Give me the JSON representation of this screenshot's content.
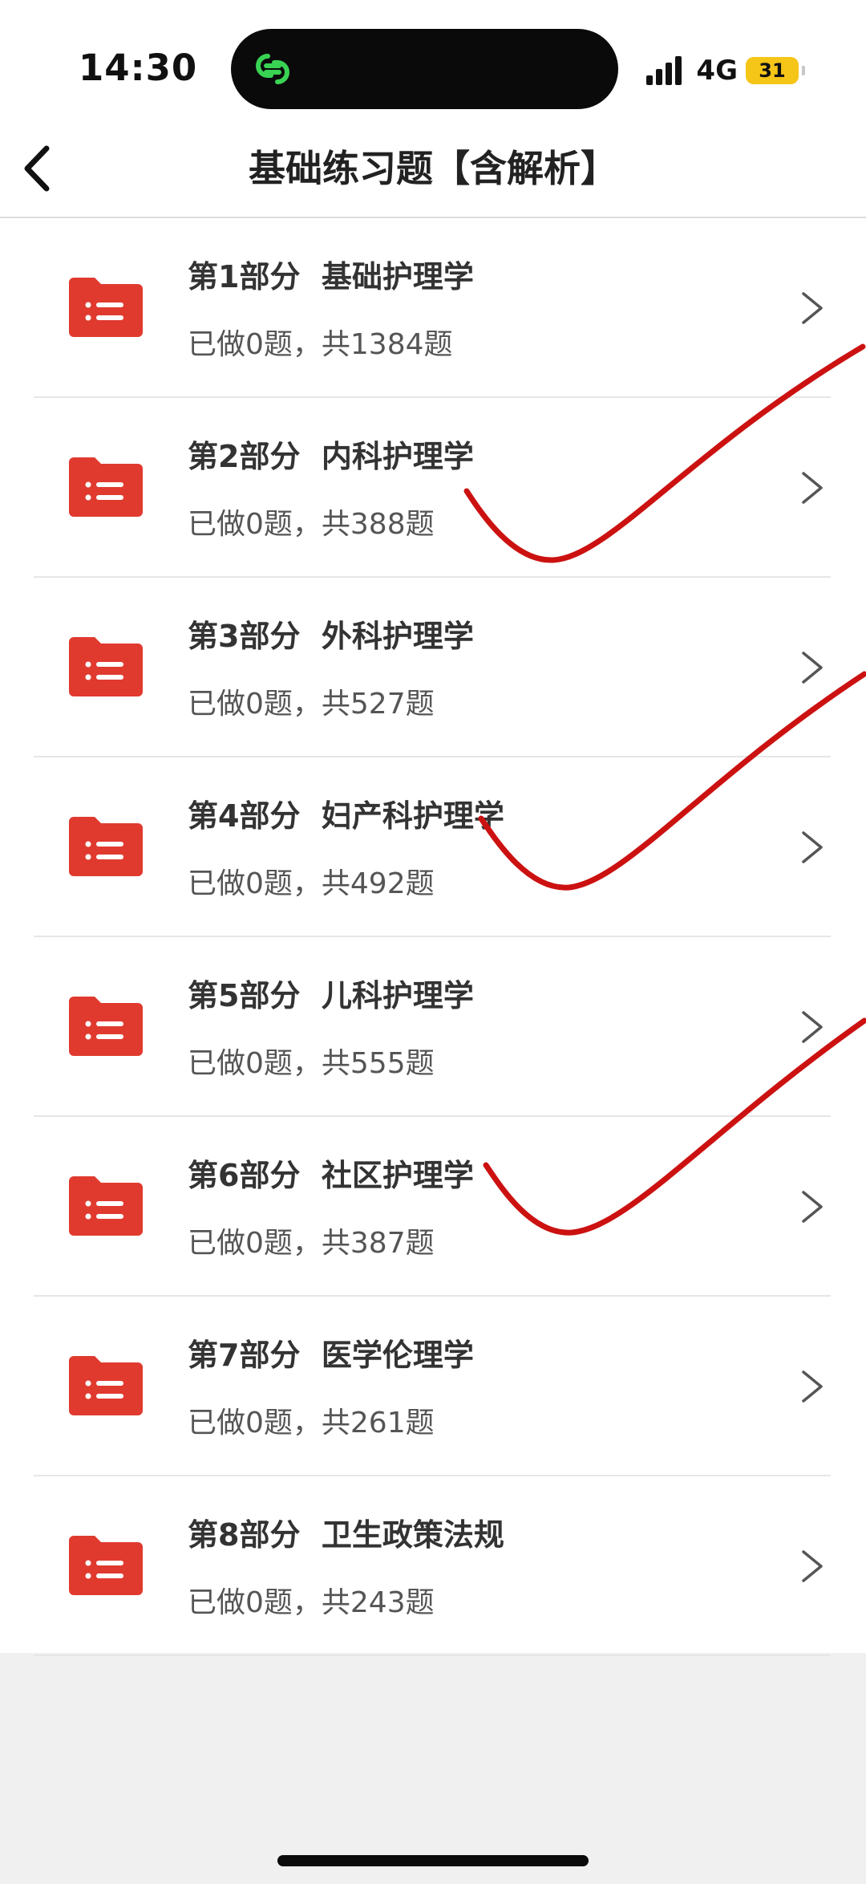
{
  "status_bar": {
    "time": "14:30",
    "network": "4G",
    "battery_level": "31",
    "battery_color": "#f5c518",
    "island_app_icon": "link-rings-icon",
    "island_icon_color": "#39d353"
  },
  "nav": {
    "back_icon": "chevron-left-icon",
    "title": "基础练习题【含解析】"
  },
  "list": {
    "icon": "list-folder-icon",
    "icon_color": "#e03a2f",
    "chevron_icon": "chevron-right-icon",
    "items": [
      {
        "title": "第1部分  基础护理学",
        "progress": "已做0题，共1384题"
      },
      {
        "title": "第2部分  内科护理学",
        "progress": "已做0题，共388题"
      },
      {
        "title": "第3部分  外科护理学",
        "progress": "已做0题，共527题"
      },
      {
        "title": "第4部分  妇产科护理学",
        "progress": "已做0题，共492题"
      },
      {
        "title": "第5部分  儿科护理学",
        "progress": "已做0题，共555题"
      },
      {
        "title": "第6部分  社区护理学",
        "progress": "已做0题，共387题"
      },
      {
        "title": "第7部分  医学伦理学",
        "progress": "已做0题，共261题"
      },
      {
        "title": "第8部分  卫生政策法规",
        "progress": "已做0题，共243题"
      }
    ]
  },
  "annotations": {
    "type": "hand-drawn-checkmark",
    "color": "#cc1111"
  }
}
